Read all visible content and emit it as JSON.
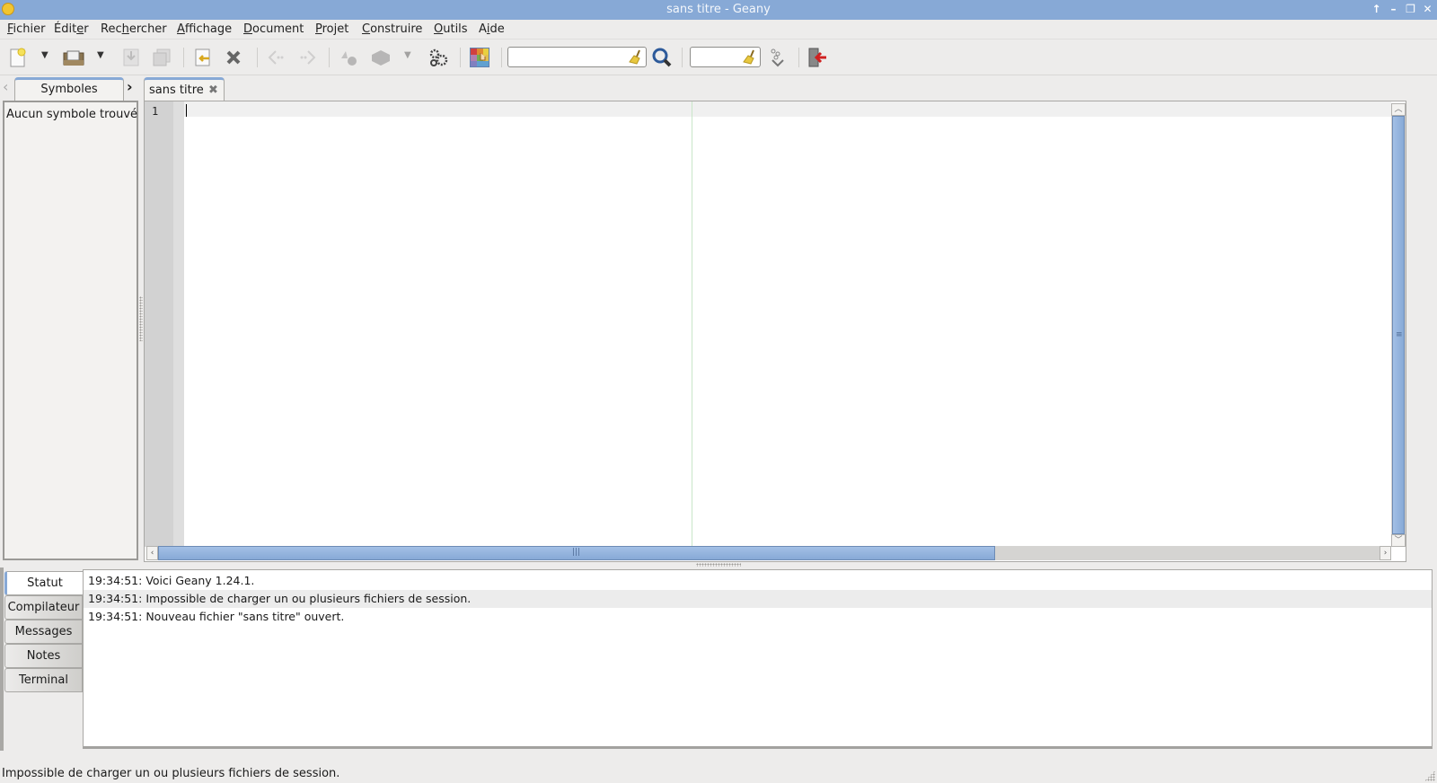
{
  "window": {
    "title": "sans titre - Geany",
    "controls": [
      "above-icon",
      "minimize-icon",
      "restore-icon",
      "close-icon"
    ]
  },
  "menubar": {
    "items": [
      {
        "label": "Fichier",
        "mnemonic": "F"
      },
      {
        "label": "Éditer",
        "mnemonic": "e"
      },
      {
        "label": "Rechercher",
        "mnemonic": "h"
      },
      {
        "label": "Affichage",
        "mnemonic": "A"
      },
      {
        "label": "Document",
        "mnemonic": "D"
      },
      {
        "label": "Projet",
        "mnemonic": "P"
      },
      {
        "label": "Construire",
        "mnemonic": "C"
      },
      {
        "label": "Outils",
        "mnemonic": "O"
      },
      {
        "label": "Aide",
        "mnemonic": "i"
      }
    ]
  },
  "toolbar": {
    "buttons": [
      {
        "name": "new-file",
        "icon": "new-file-icon",
        "enabled": true
      },
      {
        "name": "open-file",
        "icon": "open-folder-icon",
        "enabled": true
      },
      {
        "name": "save",
        "icon": "save-icon",
        "enabled": false
      },
      {
        "name": "save-all",
        "icon": "save-all-icon",
        "enabled": false
      },
      {
        "name": "revert",
        "icon": "revert-icon",
        "enabled": true
      },
      {
        "name": "close",
        "icon": "close-file-icon",
        "enabled": true
      },
      {
        "name": "navigate-back",
        "icon": "back-icon",
        "enabled": false
      },
      {
        "name": "navigate-forward",
        "icon": "forward-icon",
        "enabled": false
      },
      {
        "name": "compile",
        "icon": "compile-icon",
        "enabled": false
      },
      {
        "name": "build",
        "icon": "build-icon",
        "enabled": false
      },
      {
        "name": "run",
        "icon": "gears-icon",
        "enabled": true
      },
      {
        "name": "color-chooser",
        "icon": "color-chooser-icon",
        "enabled": true
      },
      {
        "name": "find",
        "icon": "magnifier-icon",
        "enabled": true
      },
      {
        "name": "goto-line",
        "icon": "goto-line-icon",
        "enabled": true
      },
      {
        "name": "quit",
        "icon": "quit-icon",
        "enabled": true
      }
    ],
    "search_value": "",
    "goto_value": ""
  },
  "sidebar": {
    "tab_label": "Symboles",
    "empty_message": "Aucun symbole trouvé"
  },
  "editor": {
    "tab_label": "sans titre",
    "line_numbers": [
      "1"
    ],
    "content": "",
    "vertical_scroll_fraction": 0.0,
    "horizontal_scroll_visible_fraction": 0.68
  },
  "messages": {
    "tabs": [
      "Statut",
      "Compilateur",
      "Messages",
      "Notes",
      "Terminal"
    ],
    "active_tab": "Statut",
    "log": [
      "19:34:51: Voici Geany 1.24.1.",
      "19:34:51: Impossible de charger un ou plusieurs fichiers de session.",
      "19:34:51: Nouveau fichier \"sans titre\" ouvert."
    ]
  },
  "statusbar": {
    "text": "Impossible de charger un ou plusieurs fichiers de session."
  },
  "colors": {
    "accent": "#87a9d6",
    "titlebar": "#87a9d6",
    "background": "#edeceb",
    "long_line_marker": "#c8e6c8"
  }
}
